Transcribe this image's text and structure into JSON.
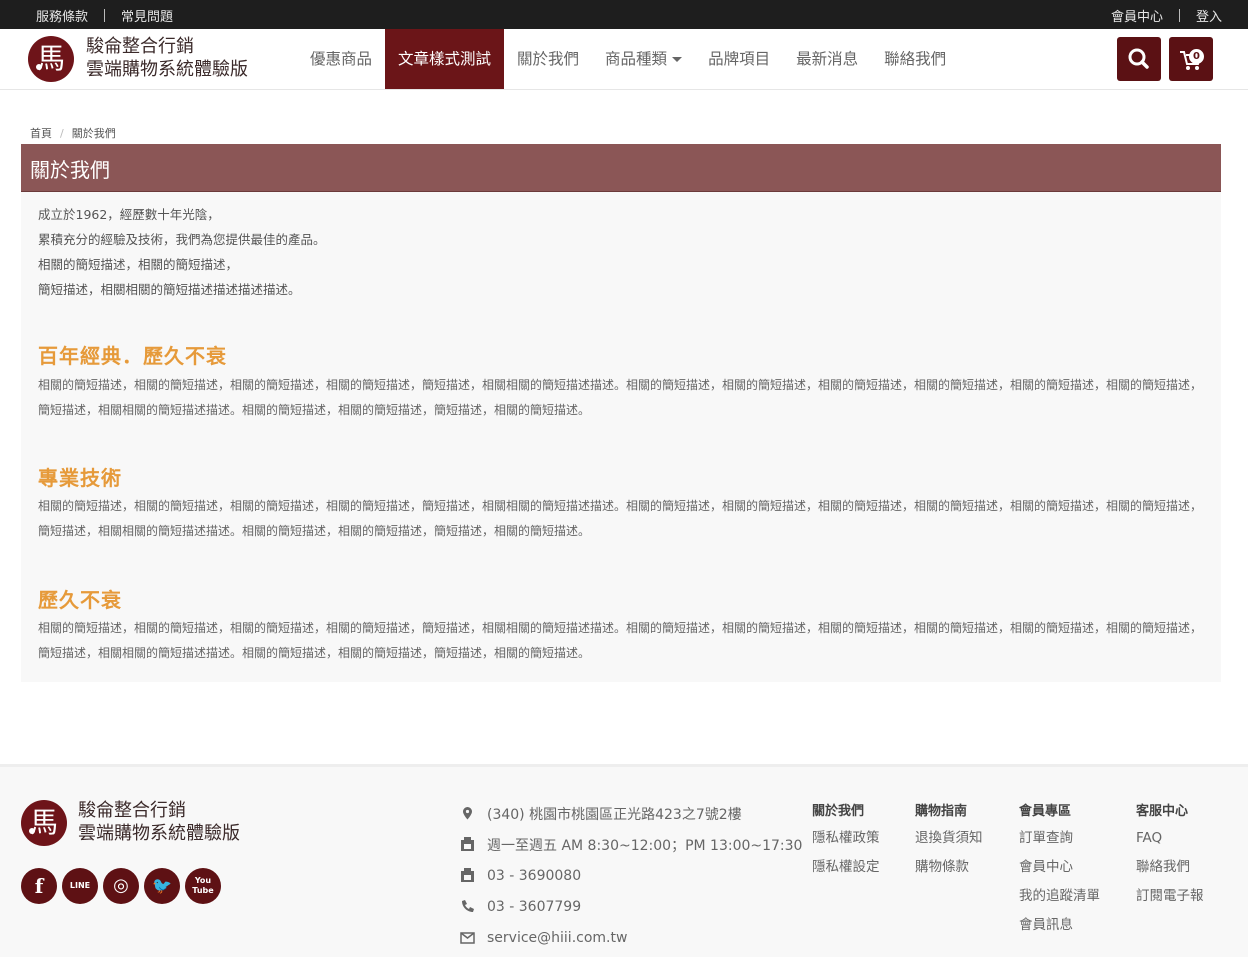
{
  "topbar": {
    "left_links": [
      "服務條款",
      "常見問題"
    ],
    "right_links": [
      "會員中心",
      "登入"
    ]
  },
  "brand": {
    "line1": "駿侖整合行銷",
    "line2": "雲端購物系統體驗版",
    "logo_char": "馬",
    "logo_icon": "horse-logo-icon"
  },
  "nav": {
    "items": [
      {
        "label": "優惠商品"
      },
      {
        "label": "文章樣式測試",
        "active": true
      },
      {
        "label": "關於我們"
      },
      {
        "label": "商品種類",
        "dropdown": true
      },
      {
        "label": "品牌項目"
      },
      {
        "label": "最新消息"
      },
      {
        "label": "聯絡我們"
      }
    ],
    "search_icon": "search-icon",
    "cart_icon": "cart-icon",
    "cart_count": "0"
  },
  "breadcrumb": {
    "home": "首頁",
    "current": "關於我們"
  },
  "page": {
    "title": "關於我們",
    "intro": [
      "成立於1962，經歷數十年光陰，",
      "累積充分的經驗及技術，我們為您提供最佳的產品。",
      "相關的簡短描述，相關的簡短描述，",
      "簡短描述，相關相關的簡短描述描述描述描述。"
    ],
    "sections": [
      {
        "title": "百年經典．歷久不衰",
        "body": "相關的簡短描述，相關的簡短描述，相關的簡短描述，相關的簡短描述，簡短描述，相關相關的簡短描述描述。相關的簡短描述，相關的簡短描述，相關的簡短描述，相關的簡短描述，相關的簡短描述，相關的簡短描述，簡短描述，相關相關的簡短描述描述。相關的簡短描述，相關的簡短描述，簡短描述，相關的簡短描述。"
      },
      {
        "title": "專業技術",
        "body": "相關的簡短描述，相關的簡短描述，相關的簡短描述，相關的簡短描述，簡短描述，相關相關的簡短描述描述。相關的簡短描述，相關的簡短描述，相關的簡短描述，相關的簡短描述，相關的簡短描述，相關的簡短描述，簡短描述，相關相關的簡短描述描述。相關的簡短描述，相關的簡短描述，簡短描述，相關的簡短描述。"
      },
      {
        "title": "歷久不衰",
        "body": "相關的簡短描述，相關的簡短描述，相關的簡短描述，相關的簡短描述，簡短描述，相關相關的簡短描述描述。相關的簡短描述，相關的簡短描述，相關的簡短描述，相關的簡短描述，相關的簡短描述，相關的簡短描述，簡短描述，相關相關的簡短描述描述。相關的簡短描述，相關的簡短描述，簡短描述，相關的簡短描述。"
      }
    ]
  },
  "footer": {
    "brand_line1": "駿侖整合行銷",
    "brand_line2": "雲端購物系統體驗版",
    "socials": [
      {
        "name": "facebook-icon",
        "glyph": "f"
      },
      {
        "name": "line-icon",
        "glyph": "LINE"
      },
      {
        "name": "instagram-icon",
        "glyph": "◎"
      },
      {
        "name": "twitter-icon",
        "glyph": "🐦"
      },
      {
        "name": "youtube-icon",
        "glyph": "You Tube"
      }
    ],
    "contacts": [
      {
        "icon": "location-icon",
        "text": "(340) 桃園市桃園區正光路423之7號2樓"
      },
      {
        "icon": "clock-icon",
        "text": "週一至週五 AM 8:30~12:00；PM 13:00~17:30"
      },
      {
        "icon": "fax-icon",
        "text": "03 - 3690080"
      },
      {
        "icon": "phone-icon",
        "text": "03 - 3607799"
      },
      {
        "icon": "mail-icon",
        "text": "service@hiii.com.tw"
      }
    ],
    "columns": [
      {
        "heading": "關於我們",
        "links": [
          "隱私權政策",
          "隱私權設定"
        ]
      },
      {
        "heading": "購物指南",
        "links": [
          "退換貨須知",
          "購物條款"
        ]
      },
      {
        "heading": "會員專區",
        "links": [
          "訂單查詢",
          "會員中心",
          "我的追蹤清單",
          "會員訊息"
        ]
      },
      {
        "heading": "客服中心",
        "links": [
          "FAQ",
          "聯絡我們",
          "訂閱電子報"
        ]
      }
    ]
  },
  "colors": {
    "topbar": "#1e1e1e",
    "brand_dark": "#6b1518",
    "title_bar": "#8b5656",
    "section_title": "#e69a3a",
    "panel_bg": "#f8f8f8"
  }
}
